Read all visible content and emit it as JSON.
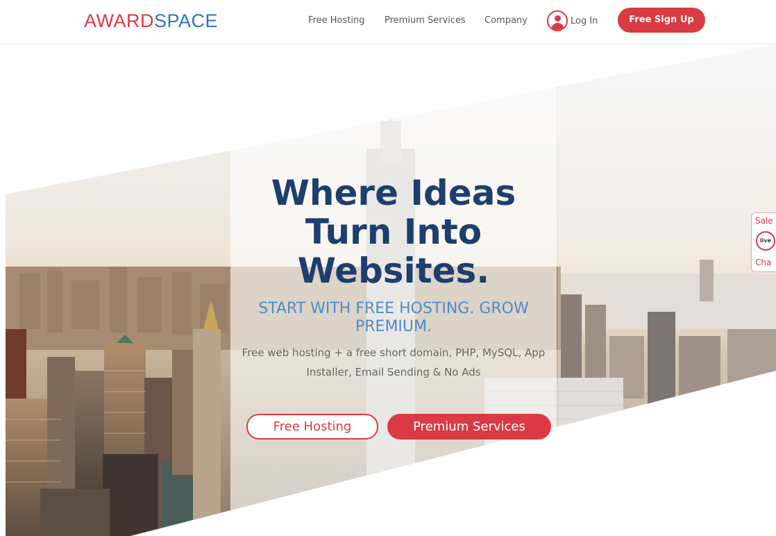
{
  "header": {
    "logo_part1": "AWARD",
    "logo_part2": "SPACE",
    "nav": [
      "Free Hosting",
      "Premium Services",
      "Company"
    ],
    "login_label": "Log In",
    "signup_label": "Free Sign Up"
  },
  "hero": {
    "headline": "Where Ideas Turn Into Websites.",
    "subheadline": "START WITH FREE HOSTING. GROW PREMIUM.",
    "description": "Free web hosting + a free short domain, PHP, MySQL, App Installer, Email Sending & No Ads",
    "button_free": "Free Hosting",
    "button_premium": "Premium Services"
  },
  "chat_tab": {
    "top_text": "Sale",
    "icon_text": "live",
    "bottom_text": "Cha"
  },
  "colors": {
    "brand_red": "#d93a44",
    "brand_blue": "#2e75bd",
    "headline_navy": "#1d3e6e",
    "subhead_blue": "#4d8cc8"
  },
  "icons": [
    "user-icon",
    "chat-bubble-icon"
  ]
}
